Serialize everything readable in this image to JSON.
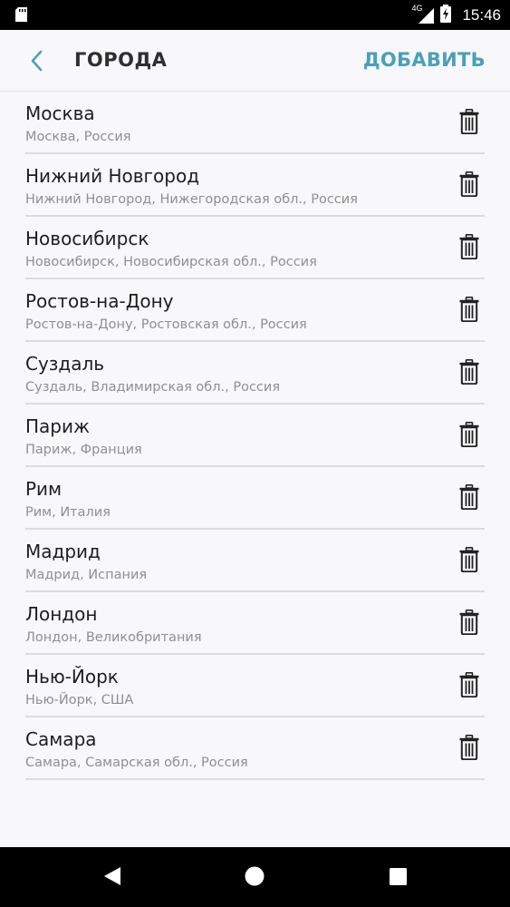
{
  "status_bar": {
    "time": "15:46",
    "network": "4G",
    "icons": [
      "sd-card-icon",
      "signal-icon",
      "battery-charging-icon"
    ]
  },
  "toolbar": {
    "title": "ГОРОДА",
    "add_label": "ДОБАВИТЬ",
    "back_icon": "chevron-left-icon",
    "accent_color": "#4aa0bb"
  },
  "cities": [
    {
      "name": "Москва",
      "detail": "Москва, Россия"
    },
    {
      "name": "Нижний Новгород",
      "detail": "Нижний Новгород, Нижегородская обл., Россия"
    },
    {
      "name": "Новосибирск",
      "detail": "Новосибирск, Новосибирская обл., Россия"
    },
    {
      "name": "Ростов-на-Дону",
      "detail": "Ростов-на-Дону, Ростовская обл., Россия"
    },
    {
      "name": "Суздаль",
      "detail": "Суздаль, Владимирская обл., Россия"
    },
    {
      "name": "Париж",
      "detail": "Париж, Франция"
    },
    {
      "name": "Рим",
      "detail": "Рим, Италия"
    },
    {
      "name": "Мадрид",
      "detail": "Мадрид, Испания"
    },
    {
      "name": "Лондон",
      "detail": "Лондон, Великобритания"
    },
    {
      "name": "Нью-Йорк",
      "detail": "Нью-Йорк, США"
    },
    {
      "name": "Самара",
      "detail": "Самара, Самарская обл., Россия"
    }
  ],
  "row_action_icon": "trash-icon",
  "nav_bar": {
    "buttons": [
      "back-triangle-icon",
      "home-circle-icon",
      "recents-square-icon"
    ]
  }
}
